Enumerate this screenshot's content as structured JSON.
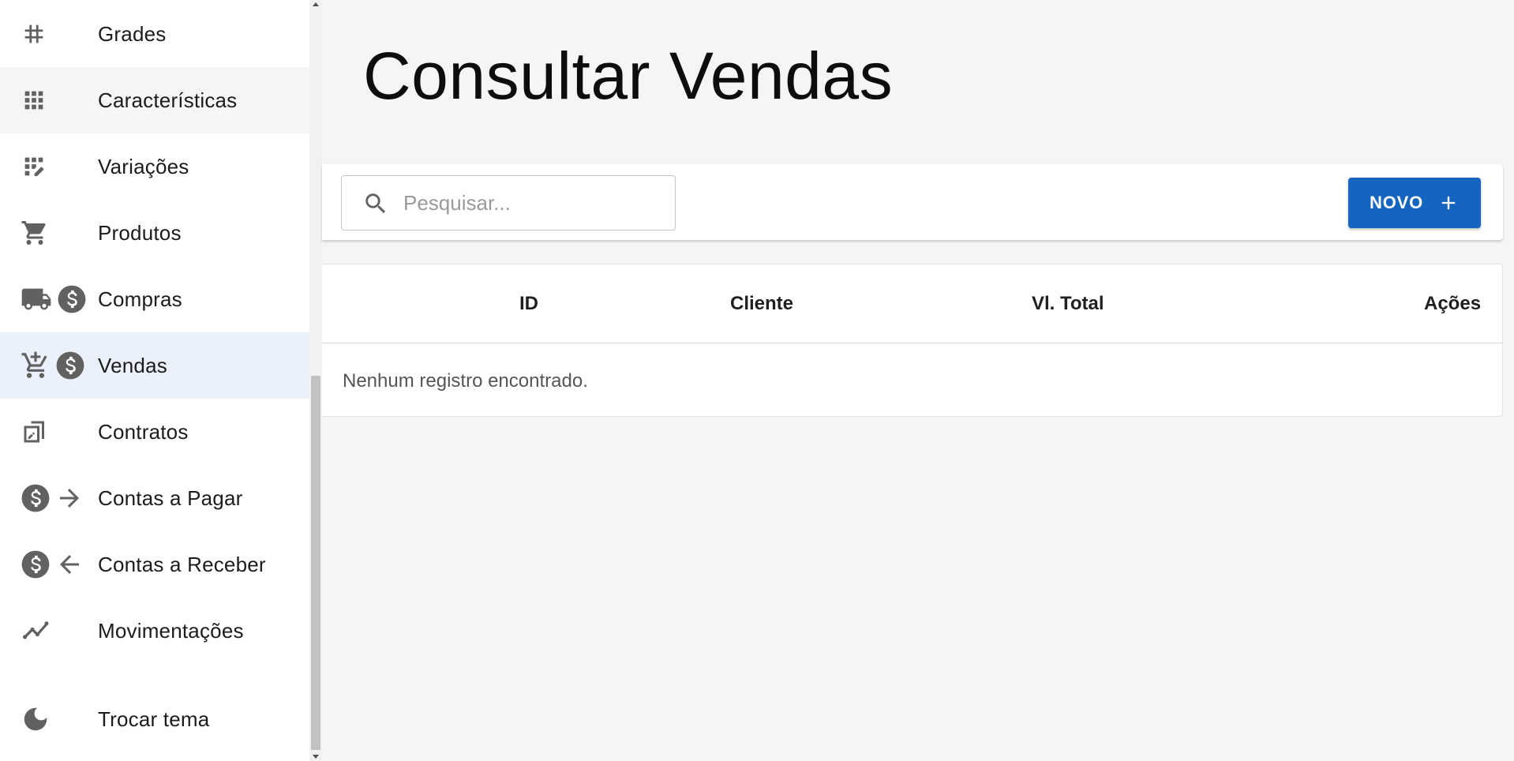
{
  "sidebar": {
    "items": [
      {
        "label": "Grades",
        "icons": [
          "hash-icon"
        ]
      },
      {
        "label": "Características",
        "icons": [
          "grid-icon"
        ]
      },
      {
        "label": "Variações",
        "icons": [
          "grid-edit-icon"
        ]
      },
      {
        "label": "Produtos",
        "icons": [
          "shopping-cart-icon"
        ]
      },
      {
        "label": "Compras",
        "icons": [
          "truck-icon",
          "dollar-circle-icon"
        ]
      },
      {
        "label": "Vendas",
        "icons": [
          "add-shopping-cart-icon",
          "dollar-circle-icon"
        ]
      },
      {
        "label": "Contratos",
        "icons": [
          "contract-icon"
        ]
      },
      {
        "label": "Contas a Pagar",
        "icons": [
          "dollar-circle-icon",
          "arrow-right-icon"
        ]
      },
      {
        "label": "Contas a Receber",
        "icons": [
          "dollar-circle-icon",
          "arrow-left-icon"
        ]
      },
      {
        "label": "Movimentações",
        "icons": [
          "trend-line-icon"
        ]
      },
      {
        "label": "Trocar tema",
        "icons": [
          "moon-icon"
        ]
      }
    ],
    "hovered_item": "Características",
    "active_item": "Vendas"
  },
  "main": {
    "title": "Consultar Vendas",
    "search": {
      "placeholder": "Pesquisar...",
      "value": ""
    },
    "new_button": {
      "label": "NOVO"
    },
    "table": {
      "columns": [
        "ID",
        "Cliente",
        "Vl. Total",
        "Ações"
      ],
      "rows": [],
      "empty_message": "Nenhum registro encontrado."
    }
  },
  "colors": {
    "accent": "#1565c0",
    "active_background": "#ebf1fa",
    "hover_background": "#f5f5f5",
    "page_background": "#f6f5f3",
    "icon_color": "#616161"
  }
}
